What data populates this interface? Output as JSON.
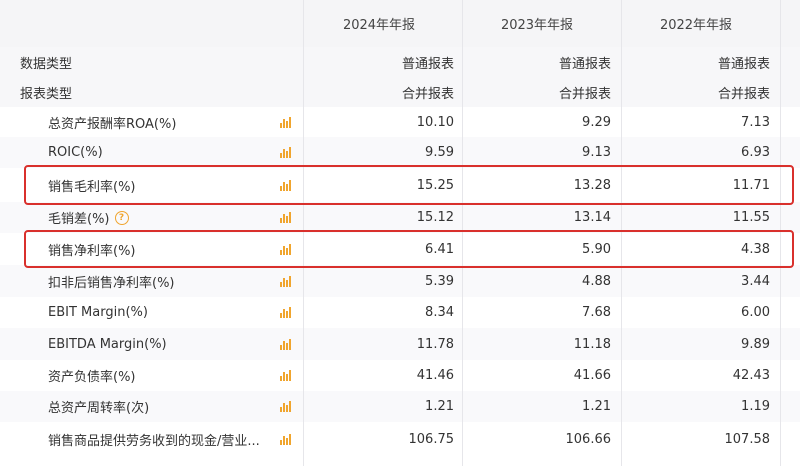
{
  "header": {
    "years": [
      "2024年年报",
      "2023年年报",
      "2022年年报"
    ]
  },
  "meta_rows": [
    {
      "label": "数据类型",
      "values": [
        "普通报表",
        "普通报表",
        "普通报表"
      ]
    },
    {
      "label": "报表类型",
      "values": [
        "合并报表",
        "合并报表",
        "合并报表"
      ]
    }
  ],
  "rows": [
    {
      "label": "总资产报酬率ROA(%)",
      "values": [
        "10.10",
        "9.29",
        "7.13"
      ]
    },
    {
      "label": "ROIC(%)",
      "values": [
        "9.59",
        "9.13",
        "6.93"
      ]
    },
    {
      "label": "销售毛利率(%)",
      "values": [
        "15.25",
        "13.28",
        "11.71"
      ]
    },
    {
      "label": "毛销差(%)",
      "values": [
        "15.12",
        "13.14",
        "11.55"
      ]
    },
    {
      "label": "销售净利率(%)",
      "values": [
        "6.41",
        "5.90",
        "4.38"
      ]
    },
    {
      "label": "扣非后销售净利率(%)",
      "values": [
        "5.39",
        "4.88",
        "3.44"
      ]
    },
    {
      "label": "EBIT Margin(%)",
      "values": [
        "8.34",
        "7.68",
        "6.00"
      ]
    },
    {
      "label": "EBITDA Margin(%)",
      "values": [
        "11.78",
        "11.18",
        "9.89"
      ]
    },
    {
      "label": "资产负债率(%)",
      "values": [
        "41.46",
        "41.66",
        "42.43"
      ]
    },
    {
      "label": "总资产周转率(次)",
      "values": [
        "1.21",
        "1.21",
        "1.19"
      ]
    },
    {
      "label": "销售商品提供劳务收到的现金/营业...",
      "values": [
        "106.75",
        "106.66",
        "107.58"
      ]
    }
  ],
  "icons": {
    "chart": "bar-chart-icon",
    "help": "question-icon"
  },
  "help_glyph": "?",
  "colors": {
    "highlight": "#d9302c",
    "icon": "#f0a52e"
  }
}
